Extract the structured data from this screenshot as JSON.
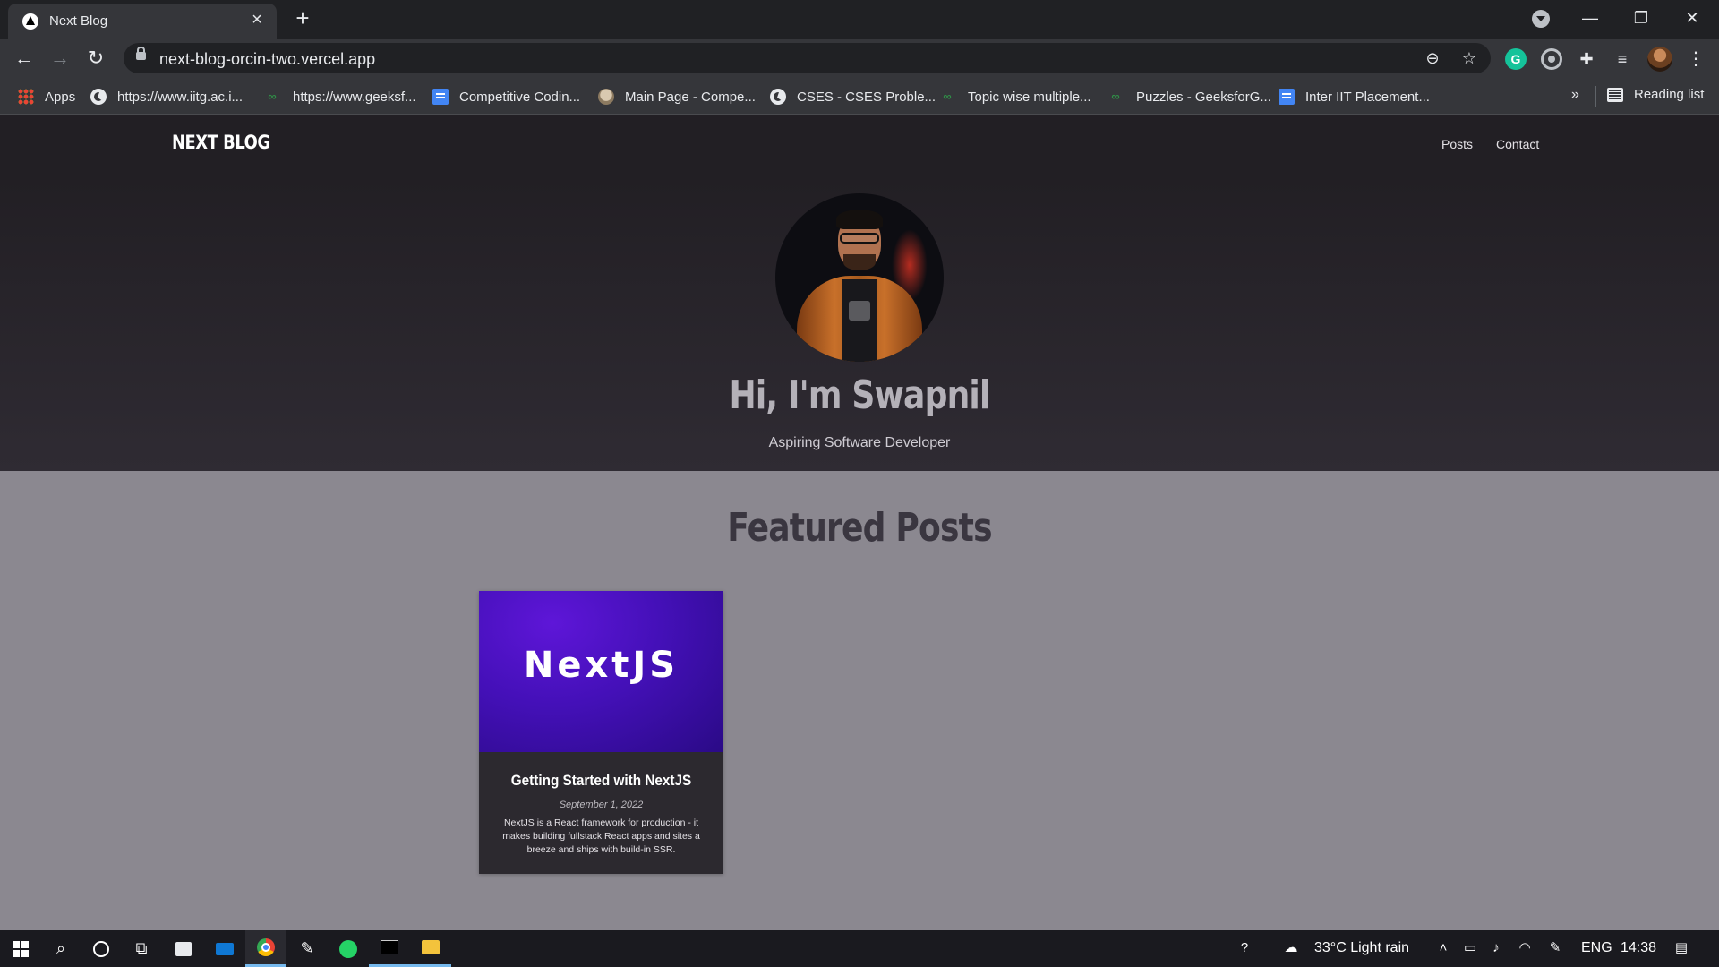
{
  "browser": {
    "tab": {
      "title": "Next Blog"
    },
    "address": {
      "url": "next-blog-orcin-two.vercel.app"
    },
    "bookmarks": [
      {
        "label": "Apps",
        "icon": "apps-grid-icon"
      },
      {
        "label": "https://www.iitg.ac.i...",
        "icon": "globe-icon"
      },
      {
        "label": "https://www.geeksf...",
        "icon": "gfg-icon"
      },
      {
        "label": "Competitive Codin...",
        "icon": "doc-icon"
      },
      {
        "label": "Main Page - Compe...",
        "icon": "wiki-icon"
      },
      {
        "label": "CSES - CSES Proble...",
        "icon": "globe-icon"
      },
      {
        "label": "Topic wise multiple...",
        "icon": "gfg-icon"
      },
      {
        "label": "Puzzles - GeeksforG...",
        "icon": "gfg-icon"
      },
      {
        "label": "Inter IIT Placement...",
        "icon": "doc-icon"
      }
    ],
    "bookmarks_more": "»",
    "reading_list": "Reading list"
  },
  "site": {
    "logo": "NEXT BLOG",
    "nav": {
      "posts": "Posts",
      "contact": "Contact"
    },
    "hero": {
      "title": "Hi, I'm Swapnil",
      "subtitle": "Aspiring Software Developer"
    },
    "featured": {
      "heading": "Featured Posts",
      "posts": [
        {
          "image_text": "NextJS",
          "title": "Getting Started with NextJS",
          "date": "September 1, 2022",
          "excerpt": "NextJS is a React framework for production - it makes building fullstack React apps and sites a breeze and ships with build-in SSR."
        }
      ]
    }
  },
  "taskbar": {
    "weather": "33°C  Light rain",
    "language": "ENG",
    "time": "14:38"
  },
  "colors": {
    "hero_bg": "#221f24",
    "featured_bg": "#8b8890",
    "card_bg": "#2c292f",
    "nextjs_purple": "#4410b8"
  }
}
